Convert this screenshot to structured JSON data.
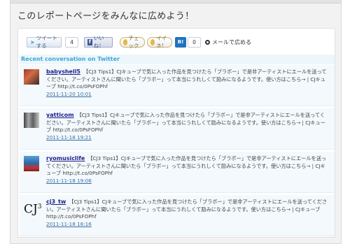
{
  "heading": "このレポートページをみんなに広めよう！",
  "share": {
    "tweet_label": "ツイートする",
    "tweet_count": "4",
    "like_label": "いいね！",
    "check_label": "チェック",
    "iine_label": "イイネ!",
    "hatena_label": "B!",
    "hatena_count": "0",
    "mail_label": "メールで広める"
  },
  "section_title": "Recent conversation on Twitter",
  "tweets": [
    {
      "user": "babyshell5",
      "text": "【CJ3 Tips1】CJキューブで気に入った作品を見つけたら「ブラボー」で是非アーティストにエールを送ってください。アーティストさんに聞いたら「ブラボー」って本当にうれしくて励みになるようです。使い方はこちら→ | CJキューブ http://t.co/0PsFOPhf",
      "time": "2011-11-20 10:01",
      "avatar": "photo"
    },
    {
      "user": "yatticom",
      "text": "【CJ3 Tips1】CJキューブで気に入った作品を見つけたら「ブラボー」で是非アーティストにエールを送ってください。アーティストさんに聞いたら「ブラボー」って本当にうれしくて励みになるようです。使い方はこちら→ | CJキューブ http://t.co/0PsFOPhf",
      "time": "2011-11-18 19:21",
      "avatar": "photo"
    },
    {
      "user": "ryomusiclife",
      "text": "【CJ3 Tips1】CJキューブで気に入った作品を見つけたら「ブラボー」で是非アーティストにエールを送ってください。アーティストさんに聞いたら「ブラボー」って本当にうれしくて励みになるようです。使い方はこちら→ | CJキューブ http://t.co/0PsFOPhf",
      "time": "2011-11-18 19:06",
      "avatar": "photo"
    },
    {
      "user": "cj3_tw",
      "text": "【CJ3 Tips1】CJキューブで気に入った作品を見つけたら「ブラボー」で是非アーティストにエールを送ってください。アーティストさんに聞いたら「ブラボー」って本当にうれしくて励みになるようです。使い方はこちら→ | CJキューブ http://t.co/0PsFOPhf",
      "time": "2011-11-18 18:16",
      "avatar": "CJ3"
    }
  ]
}
